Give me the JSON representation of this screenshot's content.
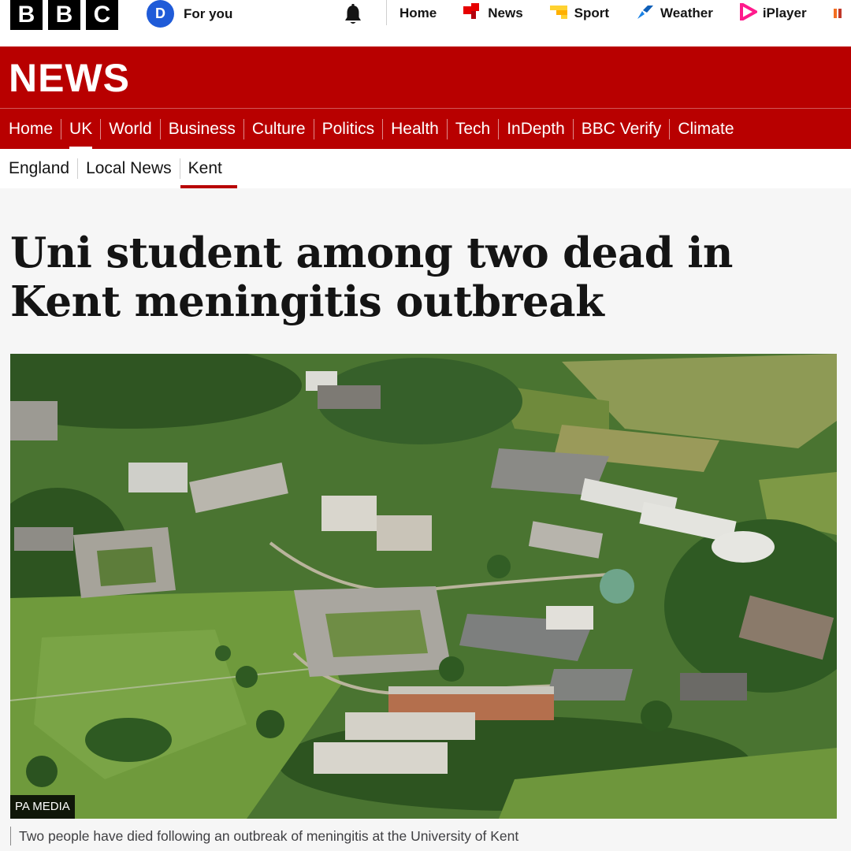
{
  "masthead": {
    "logo_letters": [
      "B",
      "B",
      "C"
    ],
    "account": {
      "avatar_initial": "D",
      "label": "For you"
    },
    "nav": [
      {
        "label": "Home",
        "icon": "none",
        "icon_color": ""
      },
      {
        "label": "News",
        "icon": "news-icon",
        "icon_color": "#e60000"
      },
      {
        "label": "Sport",
        "icon": "sport-icon",
        "icon_color": "#ffd230"
      },
      {
        "label": "Weather",
        "icon": "weather-icon",
        "icon_color": "#1a82e6"
      },
      {
        "label": "iPlayer",
        "icon": "iplayer-icon",
        "icon_color": "#ff1a8c"
      }
    ]
  },
  "news_band": {
    "wordmark": "NEWS",
    "sections": [
      "Home",
      "UK",
      "World",
      "Business",
      "Culture",
      "Politics",
      "Health",
      "Tech",
      "InDepth",
      "BBC Verify",
      "Climate"
    ],
    "active_section": "UK"
  },
  "sub_nav": {
    "items": [
      "England",
      "Local News",
      "Kent"
    ],
    "active_item": "Kent"
  },
  "article": {
    "headline": "Uni student among two dead in Kent meningitis outbreak",
    "image_credit": "PA MEDIA",
    "image_caption": "Two people have died following an outbreak of meningitis at the University of Kent"
  },
  "colors": {
    "brand_red": "#b80000",
    "avatar_blue": "#1f5bd8"
  }
}
